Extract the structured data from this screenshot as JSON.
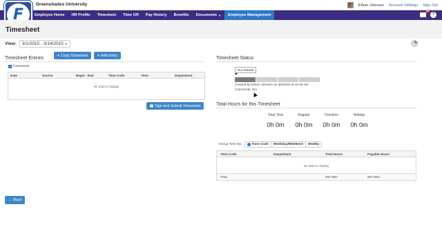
{
  "topbar": {
    "org_name": "Greenshades University",
    "user_name": "Ethan Johnson",
    "account_settings": "Account Settings",
    "sign_out": "Sign Out"
  },
  "logo": {
    "letter": "F"
  },
  "nav": {
    "items": [
      "Employee Home",
      "HR Profile",
      "Timesheet",
      "Time Off",
      "Pay History",
      "Benefits",
      "Documents",
      "Employee Management"
    ],
    "mail_badge": "68"
  },
  "page": {
    "title": "Timesheet",
    "view_label": "View:",
    "view_value": "3/1/2015 - 3/14/2015"
  },
  "entries": {
    "title": "Timesheet Entries",
    "copy_button": "Copy Timesheet",
    "add_button": "Add Entry",
    "comments_label": "Comments",
    "columns": [
      "Date",
      "Source",
      "Begin - End",
      "Time Code",
      "Time",
      "Department"
    ],
    "no_data": "No data to display",
    "submit_button": "Sign and Submit Timesheet"
  },
  "status": {
    "title": "Timesheet Status",
    "current": "Not Started",
    "created_by": "Created By Ethan Johnson on 3/9/2015 at 10:29 AM",
    "comments": "Comments: N/A"
  },
  "totals": {
    "title": "Total Hours for this Timesheet",
    "labels": [
      "Total Time",
      "Regular",
      "Overtime",
      "Holiday"
    ],
    "values": [
      "0h 0m",
      "0h 0m",
      "0h 0m",
      "0h 0m"
    ]
  },
  "group": {
    "label": "Group Time By:",
    "options": [
      "Time Code",
      "Weekday/Weekend",
      "Weekly"
    ],
    "selected": "Time Code"
  },
  "summary": {
    "columns": [
      "Time Code",
      "Department",
      "Total Hours",
      "Payable Hours"
    ],
    "no_data": "No data to display",
    "total_label": "Total",
    "total_hours": "00h 00m",
    "payable_hours": "00h 00m"
  },
  "back_button": "Back",
  "colors": {
    "nav": "#3b2d80",
    "accent": "#3f86c8",
    "active_nav": "#2c7ac3"
  }
}
